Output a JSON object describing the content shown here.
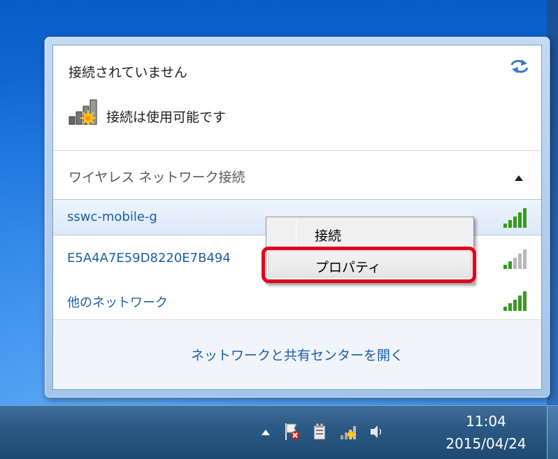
{
  "flyout": {
    "status_title": "接続されていません",
    "status_subtitle": "接続は使用可能です",
    "group_header": "ワイヤレス ネットワーク接続",
    "networks": [
      {
        "name": "sswc-mobile-g",
        "signal": "strong",
        "selected": true
      },
      {
        "name": "E5A4A7E59D8220E7B494",
        "signal": "weak",
        "selected": false
      },
      {
        "name": "他のネットワーク",
        "signal": "strong",
        "selected": false
      }
    ],
    "footer_link": "ネットワークと共有センターを開く"
  },
  "context_menu": {
    "items": [
      {
        "label": "接続"
      },
      {
        "label": "プロパティ"
      }
    ]
  },
  "taskbar": {
    "clock_time": "11:04",
    "clock_date": "2015/04/24"
  },
  "colors": {
    "link_blue": "#1a5da8",
    "signal_green": "#3a9a1e",
    "highlight_red": "#e3001e"
  },
  "icons": [
    "refresh-icon",
    "network-connection-icon",
    "chevron-up-icon",
    "signal-bars-icon",
    "show-hidden-icons",
    "action-center-flag-icon",
    "power-icon",
    "network-tray-icon",
    "volume-icon"
  ]
}
